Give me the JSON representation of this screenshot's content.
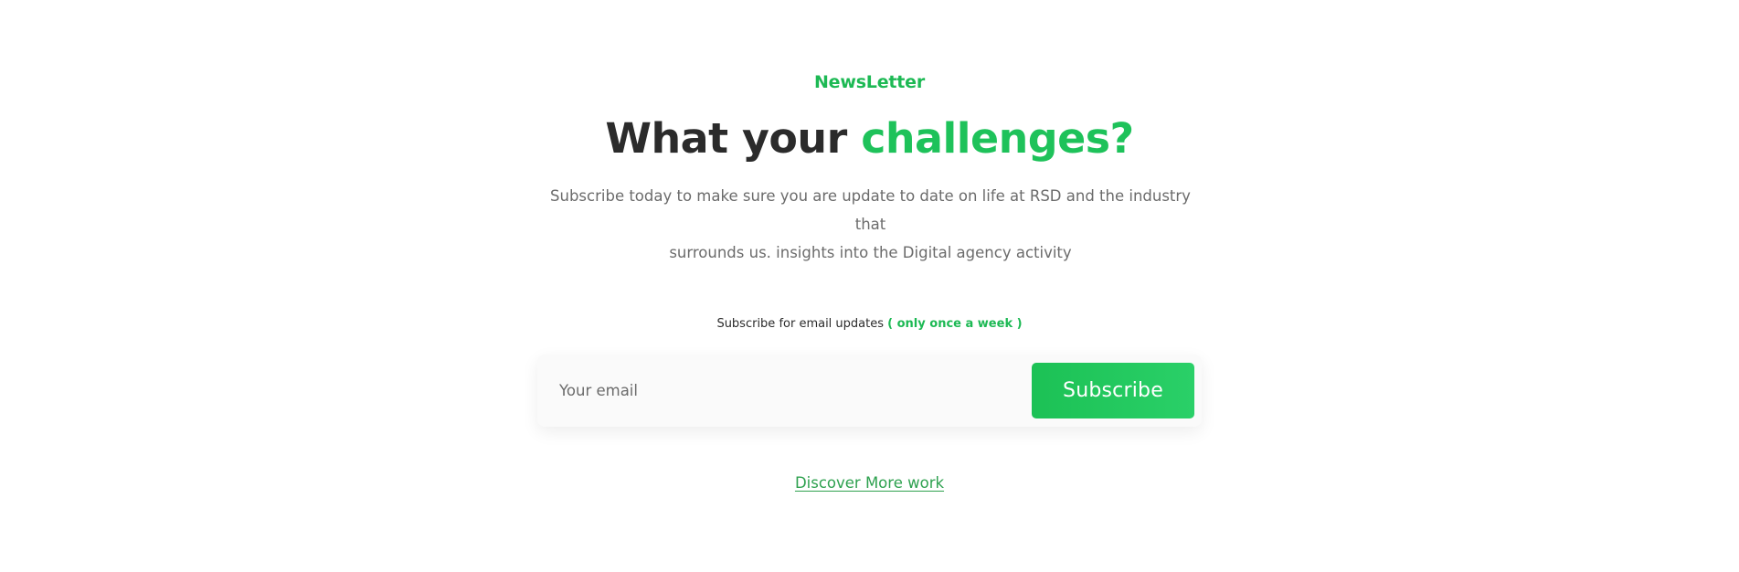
{
  "newsletter": {
    "eyebrow": "NewsLetter",
    "headline_plain": "What your ",
    "headline_accent": "challenges?",
    "description_line1": "Subscribe today to make sure you are update to date on life at RSD and the industry that",
    "description_line2": "surrounds us. insights into the Digital agency activity"
  },
  "form": {
    "caption": "Subscribe for email updates",
    "caption_note": "( only once a week )",
    "email_placeholder": "Your email",
    "subscribe_label": "Subscribe"
  },
  "footer": {
    "discover_label": "Discover More work"
  },
  "colors": {
    "accent": "#1db954",
    "button": "#1ec25a",
    "heading": "#2b2b2b",
    "body_text": "#6b6b6b"
  }
}
